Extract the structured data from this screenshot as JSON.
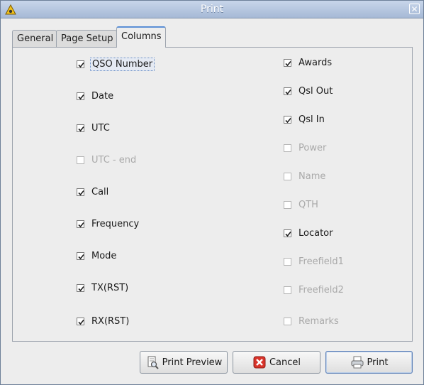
{
  "window": {
    "title": "Print"
  },
  "tabs": [
    {
      "label": "General"
    },
    {
      "label": "Page Setup"
    },
    {
      "label": "Columns"
    }
  ],
  "columns_left": [
    {
      "label": "QSO Number",
      "checked": true,
      "enabled": true
    },
    {
      "label": "Date",
      "checked": true,
      "enabled": true
    },
    {
      "label": "UTC",
      "checked": true,
      "enabled": true
    },
    {
      "label": "UTC - end",
      "checked": false,
      "enabled": false
    },
    {
      "label": "Call",
      "checked": true,
      "enabled": true
    },
    {
      "label": "Frequency",
      "checked": true,
      "enabled": true
    },
    {
      "label": "Mode",
      "checked": true,
      "enabled": true
    },
    {
      "label": "TX(RST)",
      "checked": true,
      "enabled": true
    },
    {
      "label": "RX(RST)",
      "checked": true,
      "enabled": true
    }
  ],
  "columns_right": [
    {
      "label": "Awards",
      "checked": true,
      "enabled": true
    },
    {
      "label": "Qsl Out",
      "checked": true,
      "enabled": true
    },
    {
      "label": "Qsl In",
      "checked": true,
      "enabled": true
    },
    {
      "label": "Power",
      "checked": false,
      "enabled": false
    },
    {
      "label": "Name",
      "checked": false,
      "enabled": false
    },
    {
      "label": "QTH",
      "checked": false,
      "enabled": false
    },
    {
      "label": "Locator",
      "checked": true,
      "enabled": true
    },
    {
      "label": "Freefield1",
      "checked": false,
      "enabled": false
    },
    {
      "label": "Freefield2",
      "checked": false,
      "enabled": false
    },
    {
      "label": "Remarks",
      "checked": false,
      "enabled": false
    }
  ],
  "buttons": {
    "preview": "Print Preview",
    "cancel": "Cancel",
    "print": "Print"
  }
}
